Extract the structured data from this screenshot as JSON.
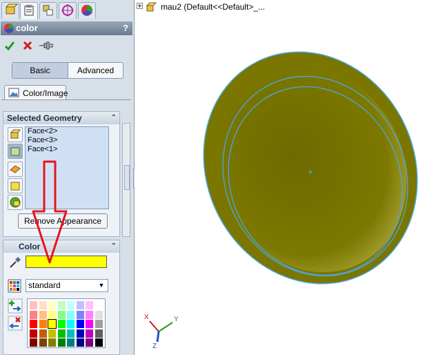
{
  "window": {
    "title": "color"
  },
  "tabs": [
    "feature-manager",
    "property-manager",
    "configuration-manager",
    "dimxpert-manager",
    "display-manager"
  ],
  "title_bar": {
    "title": "color",
    "help": "?"
  },
  "actions": {
    "ok_icon": "check-icon",
    "cancel_icon": "x-icon",
    "pin_icon": "pushpin-icon"
  },
  "mode": {
    "basic": "Basic",
    "advanced": "Advanced",
    "selected": "Basic"
  },
  "subtab": {
    "label": "Color/Image"
  },
  "selected_geometry": {
    "header": "Selected Geometry",
    "items": [
      "Face<2>",
      "Face<3>",
      "Face<1>"
    ],
    "remove_button": "Remove Appearance",
    "filters": [
      "part-filter",
      "face-filter",
      "surface-filter",
      "body-filter",
      "feature-filter"
    ]
  },
  "color": {
    "header": "Color",
    "current_hex": "#ffff00",
    "palette_select": "standard",
    "palette_rows": [
      [
        "#ffc0c0",
        "#ffe0c0",
        "#ffffc0",
        "#c0ffc0",
        "#c0ffff",
        "#c0c0ff",
        "#ffc0ff",
        "#ffffff"
      ],
      [
        "#ff8080",
        "#ffc080",
        "#ffff80",
        "#80ff80",
        "#80ffff",
        "#8080ff",
        "#ff80ff",
        "#e0e0e0"
      ],
      [
        "#ff0000",
        "#ff8000",
        "#ffff00",
        "#00ff00",
        "#00ffff",
        "#0000ff",
        "#ff00ff",
        "#a0a0a0"
      ],
      [
        "#c00000",
        "#c06000",
        "#c0c000",
        "#00c000",
        "#00c0c0",
        "#0000c0",
        "#c000c0",
        "#606060"
      ],
      [
        "#800000",
        "#804000",
        "#808000",
        "#008000",
        "#008080",
        "#000080",
        "#800080",
        "#000000"
      ]
    ]
  },
  "tree": {
    "part_label": "mau2  (Default<<Default>_..."
  },
  "triad": {
    "x": "X",
    "y": "Y",
    "z": "Z"
  },
  "colors": {
    "model_fill": "#7a7600",
    "model_edge": "#4aa8e0",
    "annotation": "#e8141b"
  }
}
